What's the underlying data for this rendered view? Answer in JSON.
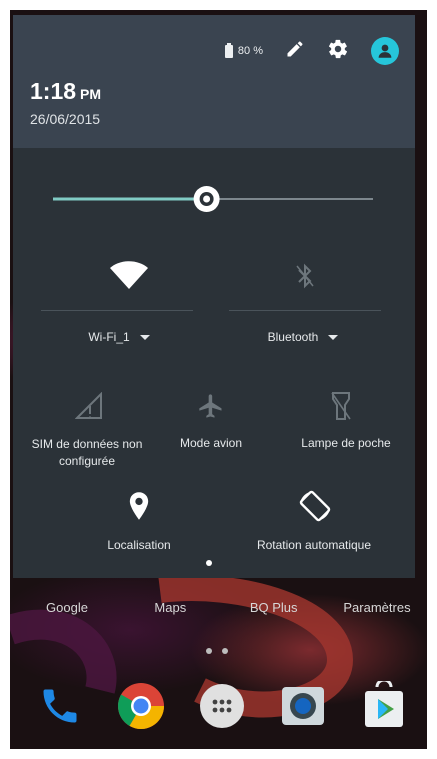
{
  "home": {
    "apps": [
      "Google",
      "Maps",
      "BQ Plus",
      "Paramètres"
    ],
    "dock_apps": [
      "phone-icon",
      "chrome-icon",
      "app-drawer-icon",
      "camera-icon",
      "play-store-icon"
    ]
  },
  "header": {
    "battery_text": "80 %",
    "time": "1:18",
    "ampm": "PM",
    "date": "26/06/2015",
    "icons": [
      "battery-icon",
      "edit-icon",
      "gear-icon",
      "account-icon"
    ]
  },
  "quick_settings": {
    "brightness_percent": 48,
    "wifi": {
      "label": "Wi-Fi_1",
      "enabled": true
    },
    "bluetooth": {
      "label": "Bluetooth",
      "enabled": false
    },
    "sim": {
      "label_line1": "SIM de données non",
      "label_line2": "configurée"
    },
    "airplane": {
      "label": "Mode avion"
    },
    "flashlight": {
      "label": "Lampe de poche"
    },
    "location": {
      "label": "Localisation"
    },
    "rotation": {
      "label": "Rotation automatique"
    }
  },
  "colors": {
    "header_bg": "#3a4450",
    "panel_bg": "#2b3238",
    "accent": "#80cbc4",
    "avatar": "#26c6da"
  }
}
